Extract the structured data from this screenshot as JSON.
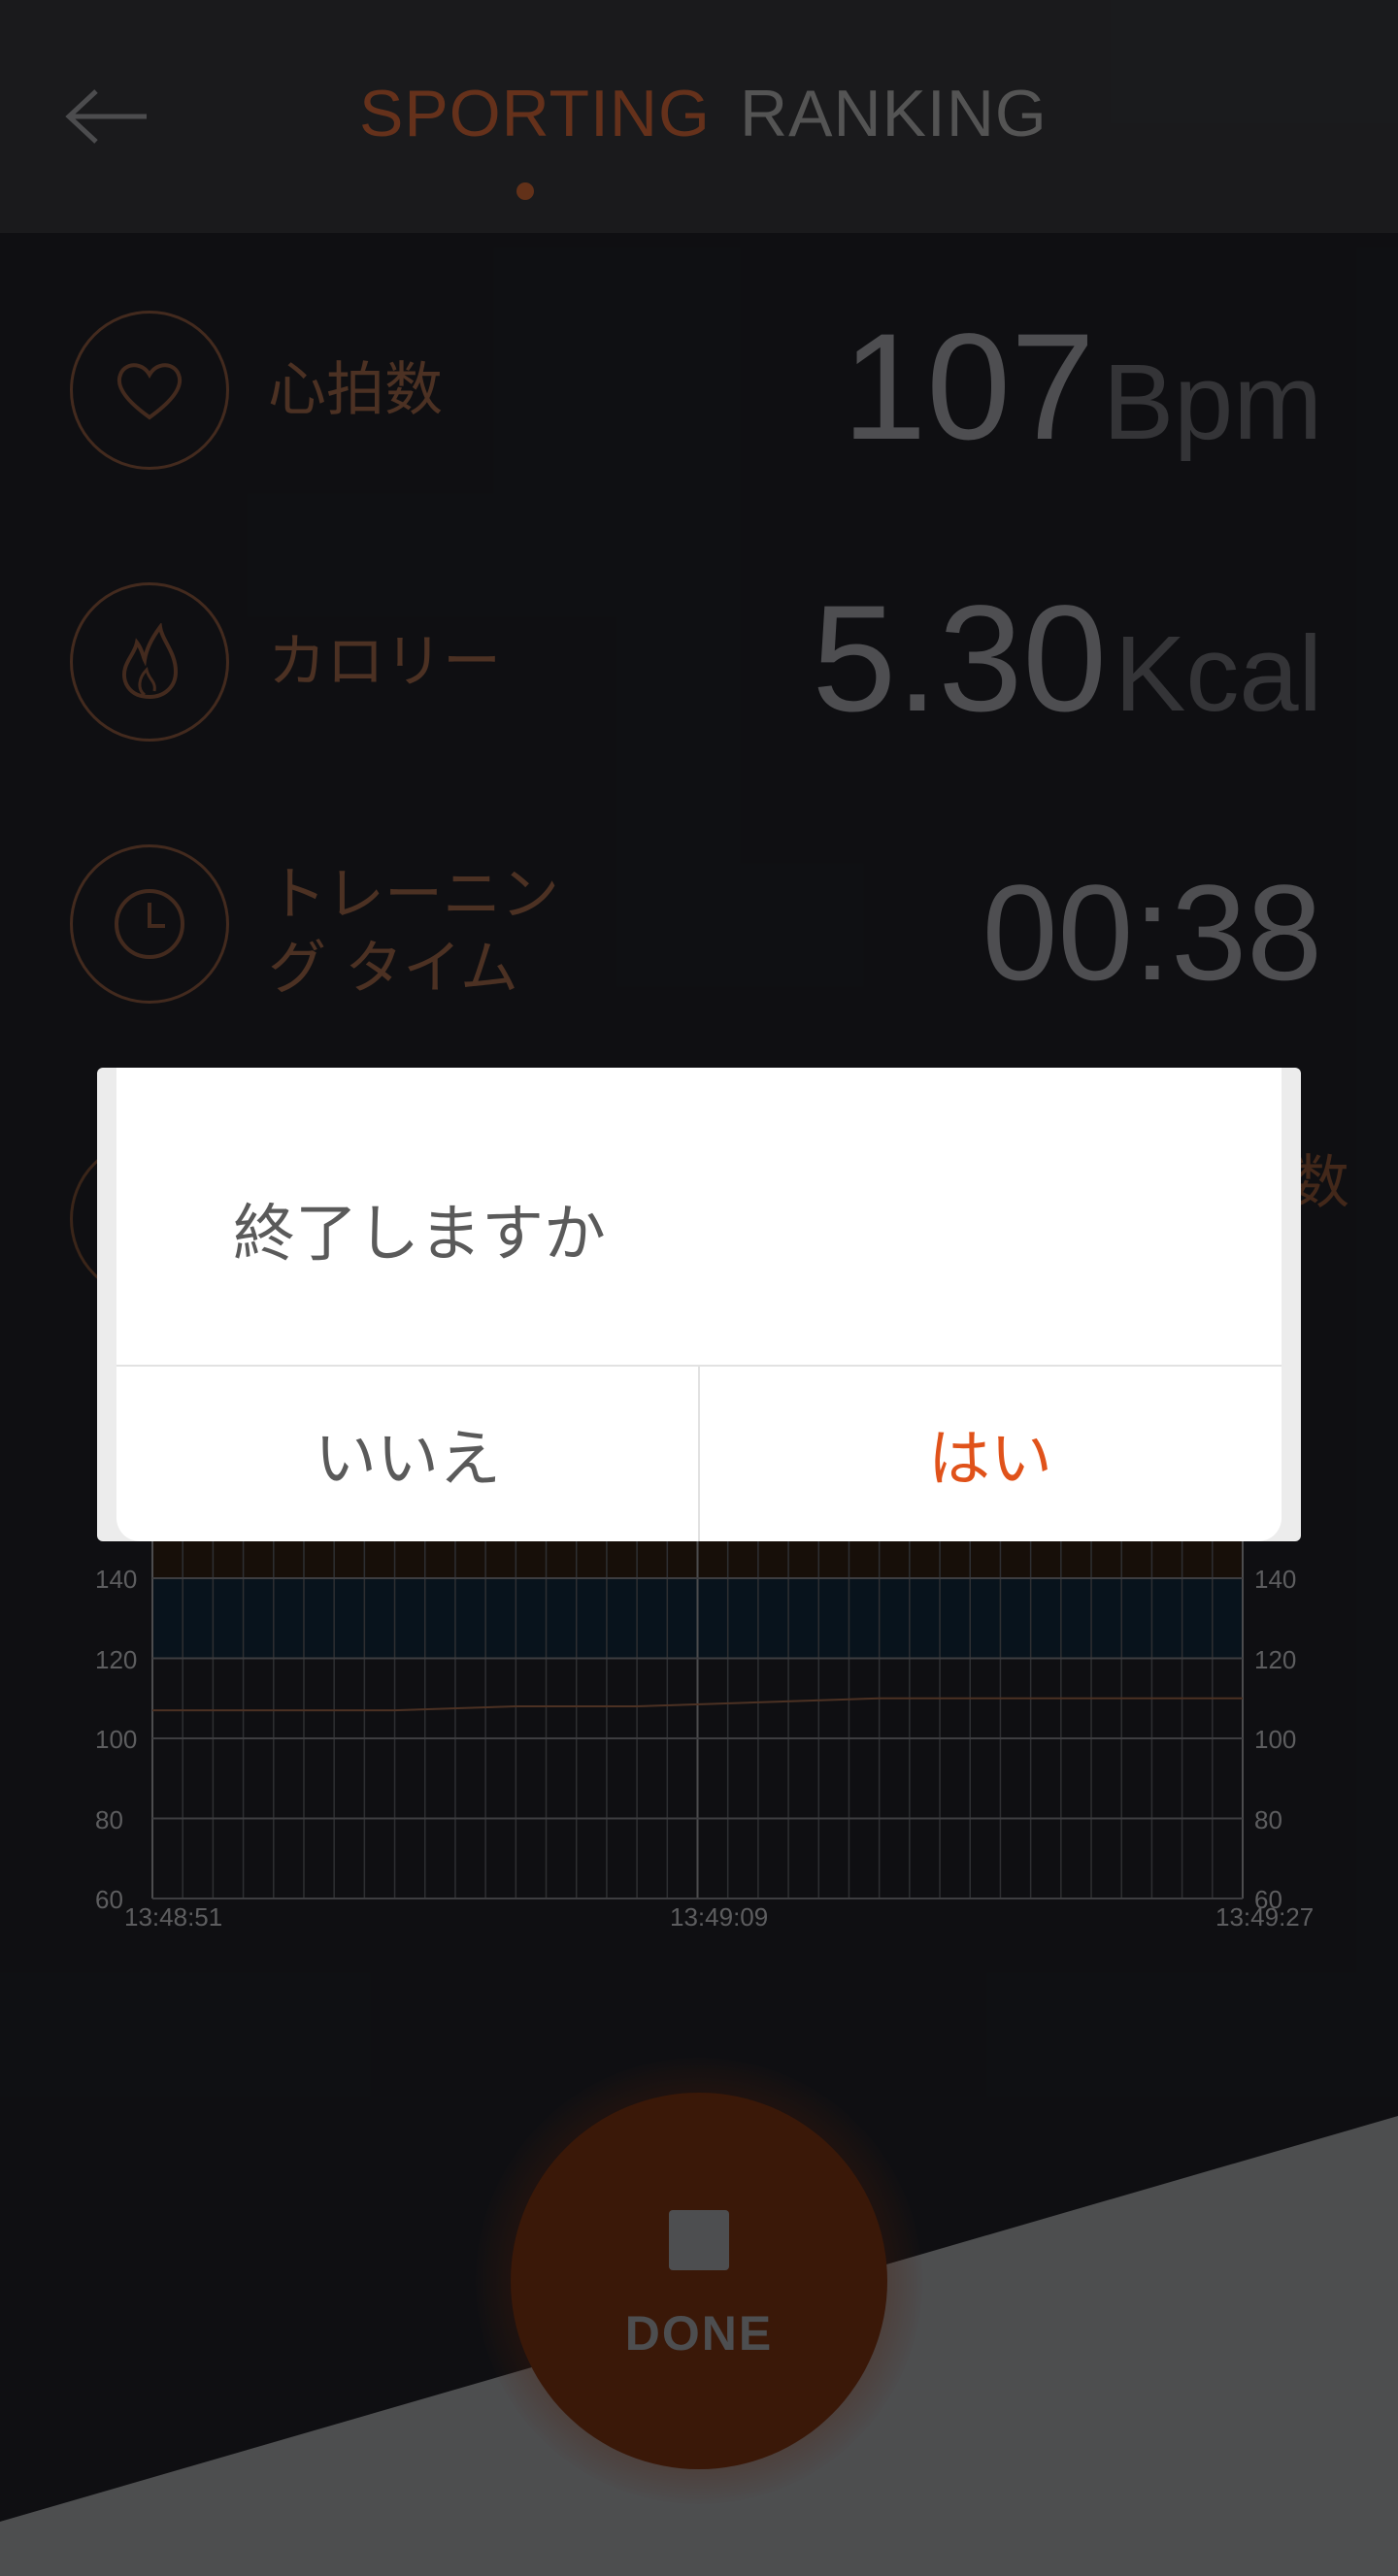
{
  "header": {
    "tabs": [
      {
        "label": "SPORTING",
        "active": true
      },
      {
        "label": "RANKING",
        "active": false
      }
    ]
  },
  "metrics": [
    {
      "label": "心拍数",
      "value": "107",
      "unit": "Bpm",
      "icon": "heart-icon"
    },
    {
      "label": "カロリー",
      "value": "5.30",
      "unit": "Kcal",
      "icon": "flame-icon"
    },
    {
      "label_line1": "トレーニン",
      "label_line2": "グ タイム",
      "value": "00:38",
      "icon": "clock-icon"
    }
  ],
  "hidden_row_peek": "数",
  "chart_data": {
    "type": "line",
    "y_ticks_left": [
      "140",
      "120",
      "100",
      "80",
      "60"
    ],
    "y_ticks_right": [
      "140",
      "120",
      "100",
      "80",
      "60"
    ],
    "x_ticks": [
      "13:48:51",
      "13:49:09",
      "13:49:27"
    ],
    "ylim": [
      60,
      140
    ],
    "series": [
      {
        "x": [
          "13:48:51",
          "13:48:55",
          "13:48:59",
          "13:49:03",
          "13:49:07",
          "13:49:11",
          "13:49:15",
          "13:49:19",
          "13:49:23",
          "13:49:27"
        ],
        "values": [
          107,
          107,
          107,
          108,
          108,
          109,
          110,
          110,
          110,
          110
        ]
      }
    ],
    "zones": [
      {
        "from": 120,
        "to": 140,
        "color": "#0f2433"
      },
      {
        "from": 140,
        "to": 150,
        "color": "#2a1d12"
      }
    ]
  },
  "done_button": {
    "label": "DONE"
  },
  "dialog": {
    "title": "終了しますか",
    "no_label": "いいえ",
    "yes_label": "はい"
  },
  "colors": {
    "accent": "#e0521a",
    "tab_active": "#b85a32",
    "icon_ring": "#7a4e38"
  }
}
